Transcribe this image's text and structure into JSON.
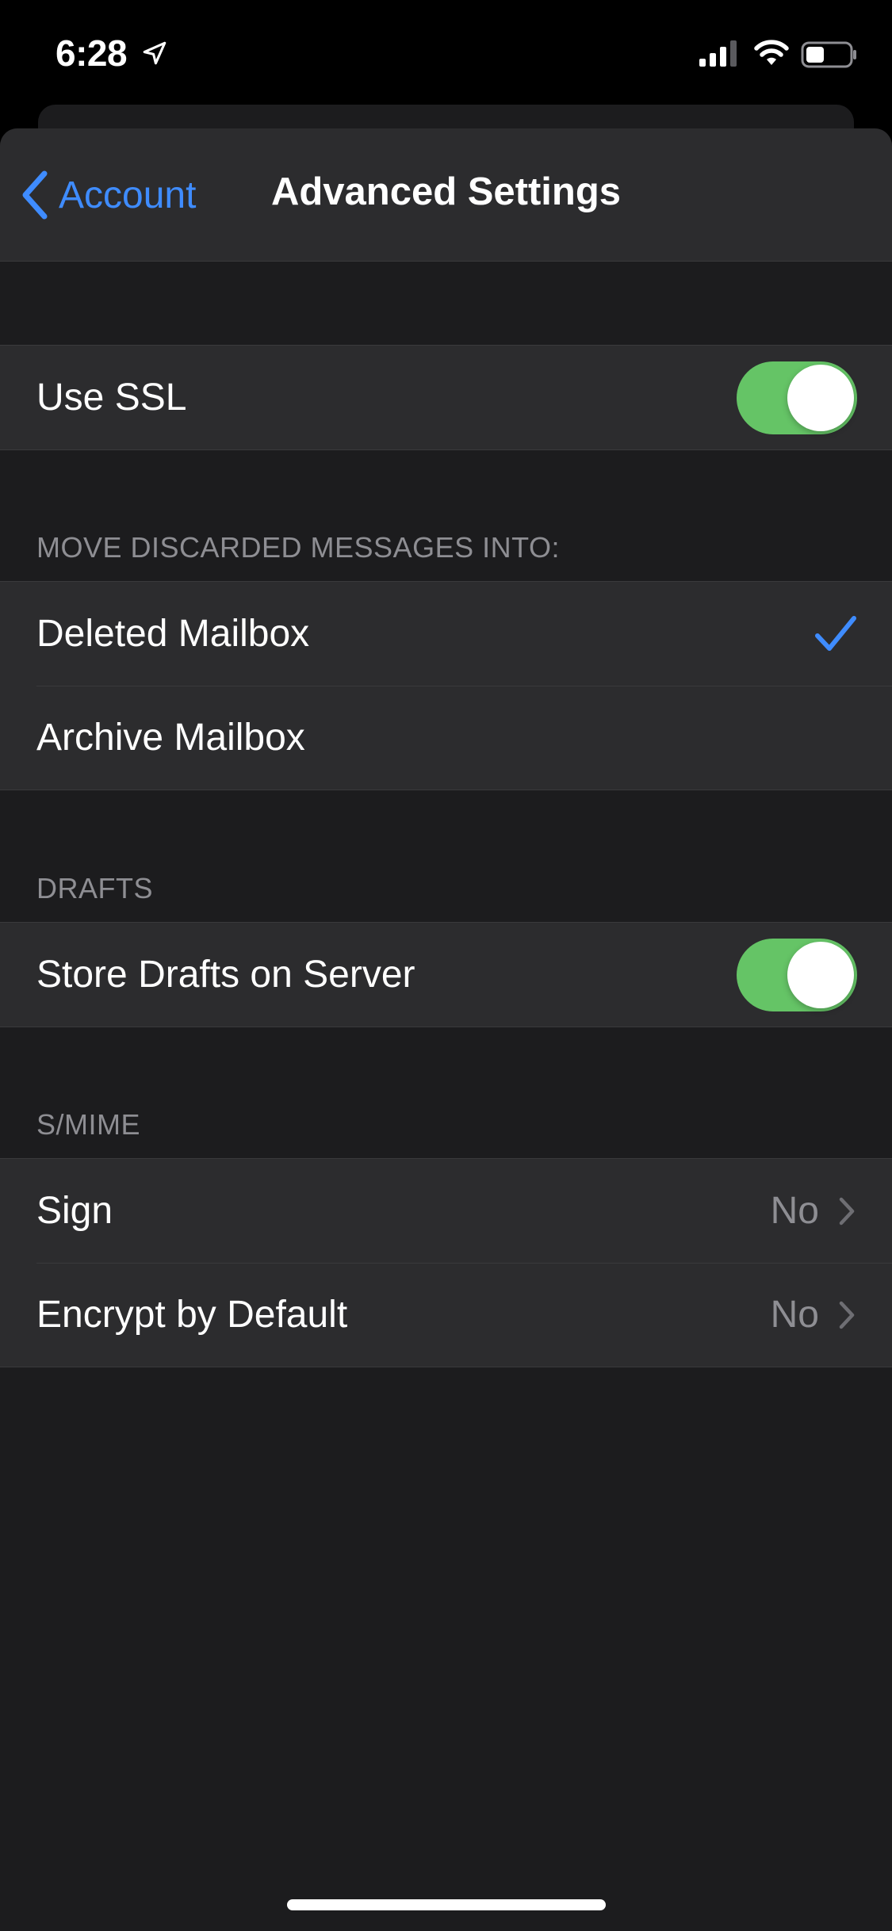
{
  "status_bar": {
    "time": "6:28",
    "icons": [
      "location-arrow-icon",
      "cellular-signal-icon",
      "wifi-icon",
      "battery-icon"
    ]
  },
  "nav": {
    "back_label": "Account",
    "title": "Advanced Settings"
  },
  "ssl": {
    "label": "Use SSL",
    "enabled": true
  },
  "discard": {
    "header": "MOVE DISCARDED MESSAGES INTO:",
    "options": [
      {
        "label": "Deleted Mailbox",
        "selected": true
      },
      {
        "label": "Archive Mailbox",
        "selected": false
      }
    ]
  },
  "drafts": {
    "header": "DRAFTS",
    "label": "Store Drafts on Server",
    "enabled": true
  },
  "smime": {
    "header": "S/MIME",
    "rows": [
      {
        "label": "Sign",
        "value": "No"
      },
      {
        "label": "Encrypt by Default",
        "value": "No"
      }
    ]
  },
  "colors": {
    "accent": "#3f8cff",
    "toggle_on": "#65c466",
    "background": "#1c1c1e",
    "cell": "#2c2c2e",
    "secondary_text": "#8e8e93"
  }
}
